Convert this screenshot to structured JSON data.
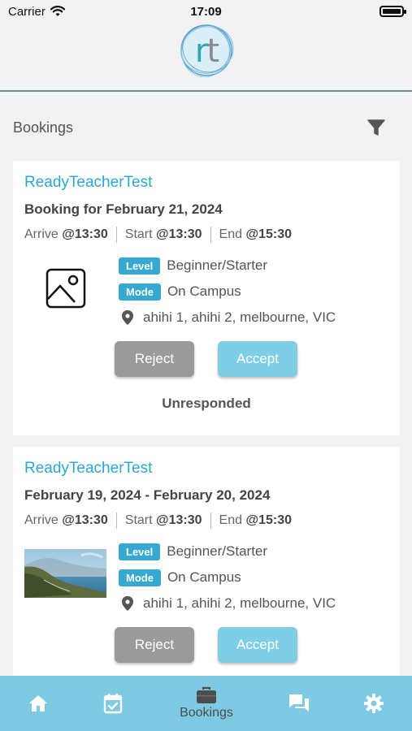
{
  "status_bar": {
    "carrier": "Carrier",
    "time": "17:09"
  },
  "header": {
    "logo_text_r": "r",
    "logo_text_t": "t"
  },
  "section": {
    "title": "Bookings"
  },
  "bookings": [
    {
      "teacher": "ReadyTeacherTest",
      "date": "Booking for February 21, 2024",
      "arrive_label": "Arrive",
      "arrive_time": "@13:30",
      "start_label": "Start",
      "start_time": "@13:30",
      "end_label": "End",
      "end_time": "@15:30",
      "level_label": "Level",
      "level_value": "Beginner/Starter",
      "mode_label": "Mode",
      "mode_value": "On Campus",
      "address": "ahihi 1, ahihi 2, melbourne, VIC",
      "image": "image-placeholder-icon",
      "reject_label": "Reject",
      "accept_label": "Accept",
      "status": "Unresponded"
    },
    {
      "teacher": "ReadyTeacherTest",
      "date": "February 19, 2024 - February 20, 2024",
      "arrive_label": "Arrive",
      "arrive_time": "@13:30",
      "start_label": "Start",
      "start_time": "@13:30",
      "end_label": "End",
      "end_time": "@15:30",
      "level_label": "Level",
      "level_value": "Beginner/Starter",
      "mode_label": "Mode",
      "mode_value": "On Campus",
      "address": "ahihi 1, ahihi 2, melbourne, VIC",
      "image": "coastline-photo",
      "reject_label": "Reject",
      "accept_label": "Accept"
    }
  ],
  "bottom_nav": {
    "items": [
      {
        "icon": "home-icon"
      },
      {
        "icon": "calendar-check-icon"
      },
      {
        "icon": "briefcase-icon",
        "label": "Bookings",
        "active": true
      },
      {
        "icon": "chat-icon"
      },
      {
        "icon": "gear-icon"
      }
    ]
  },
  "colors": {
    "accent": "#2ba8d4",
    "badge": "#35a8d4",
    "nav_bar": "#7ecae3",
    "reject": "#9a9a9a",
    "accept": "#80cde6",
    "header_border": "#6f8aa3"
  }
}
